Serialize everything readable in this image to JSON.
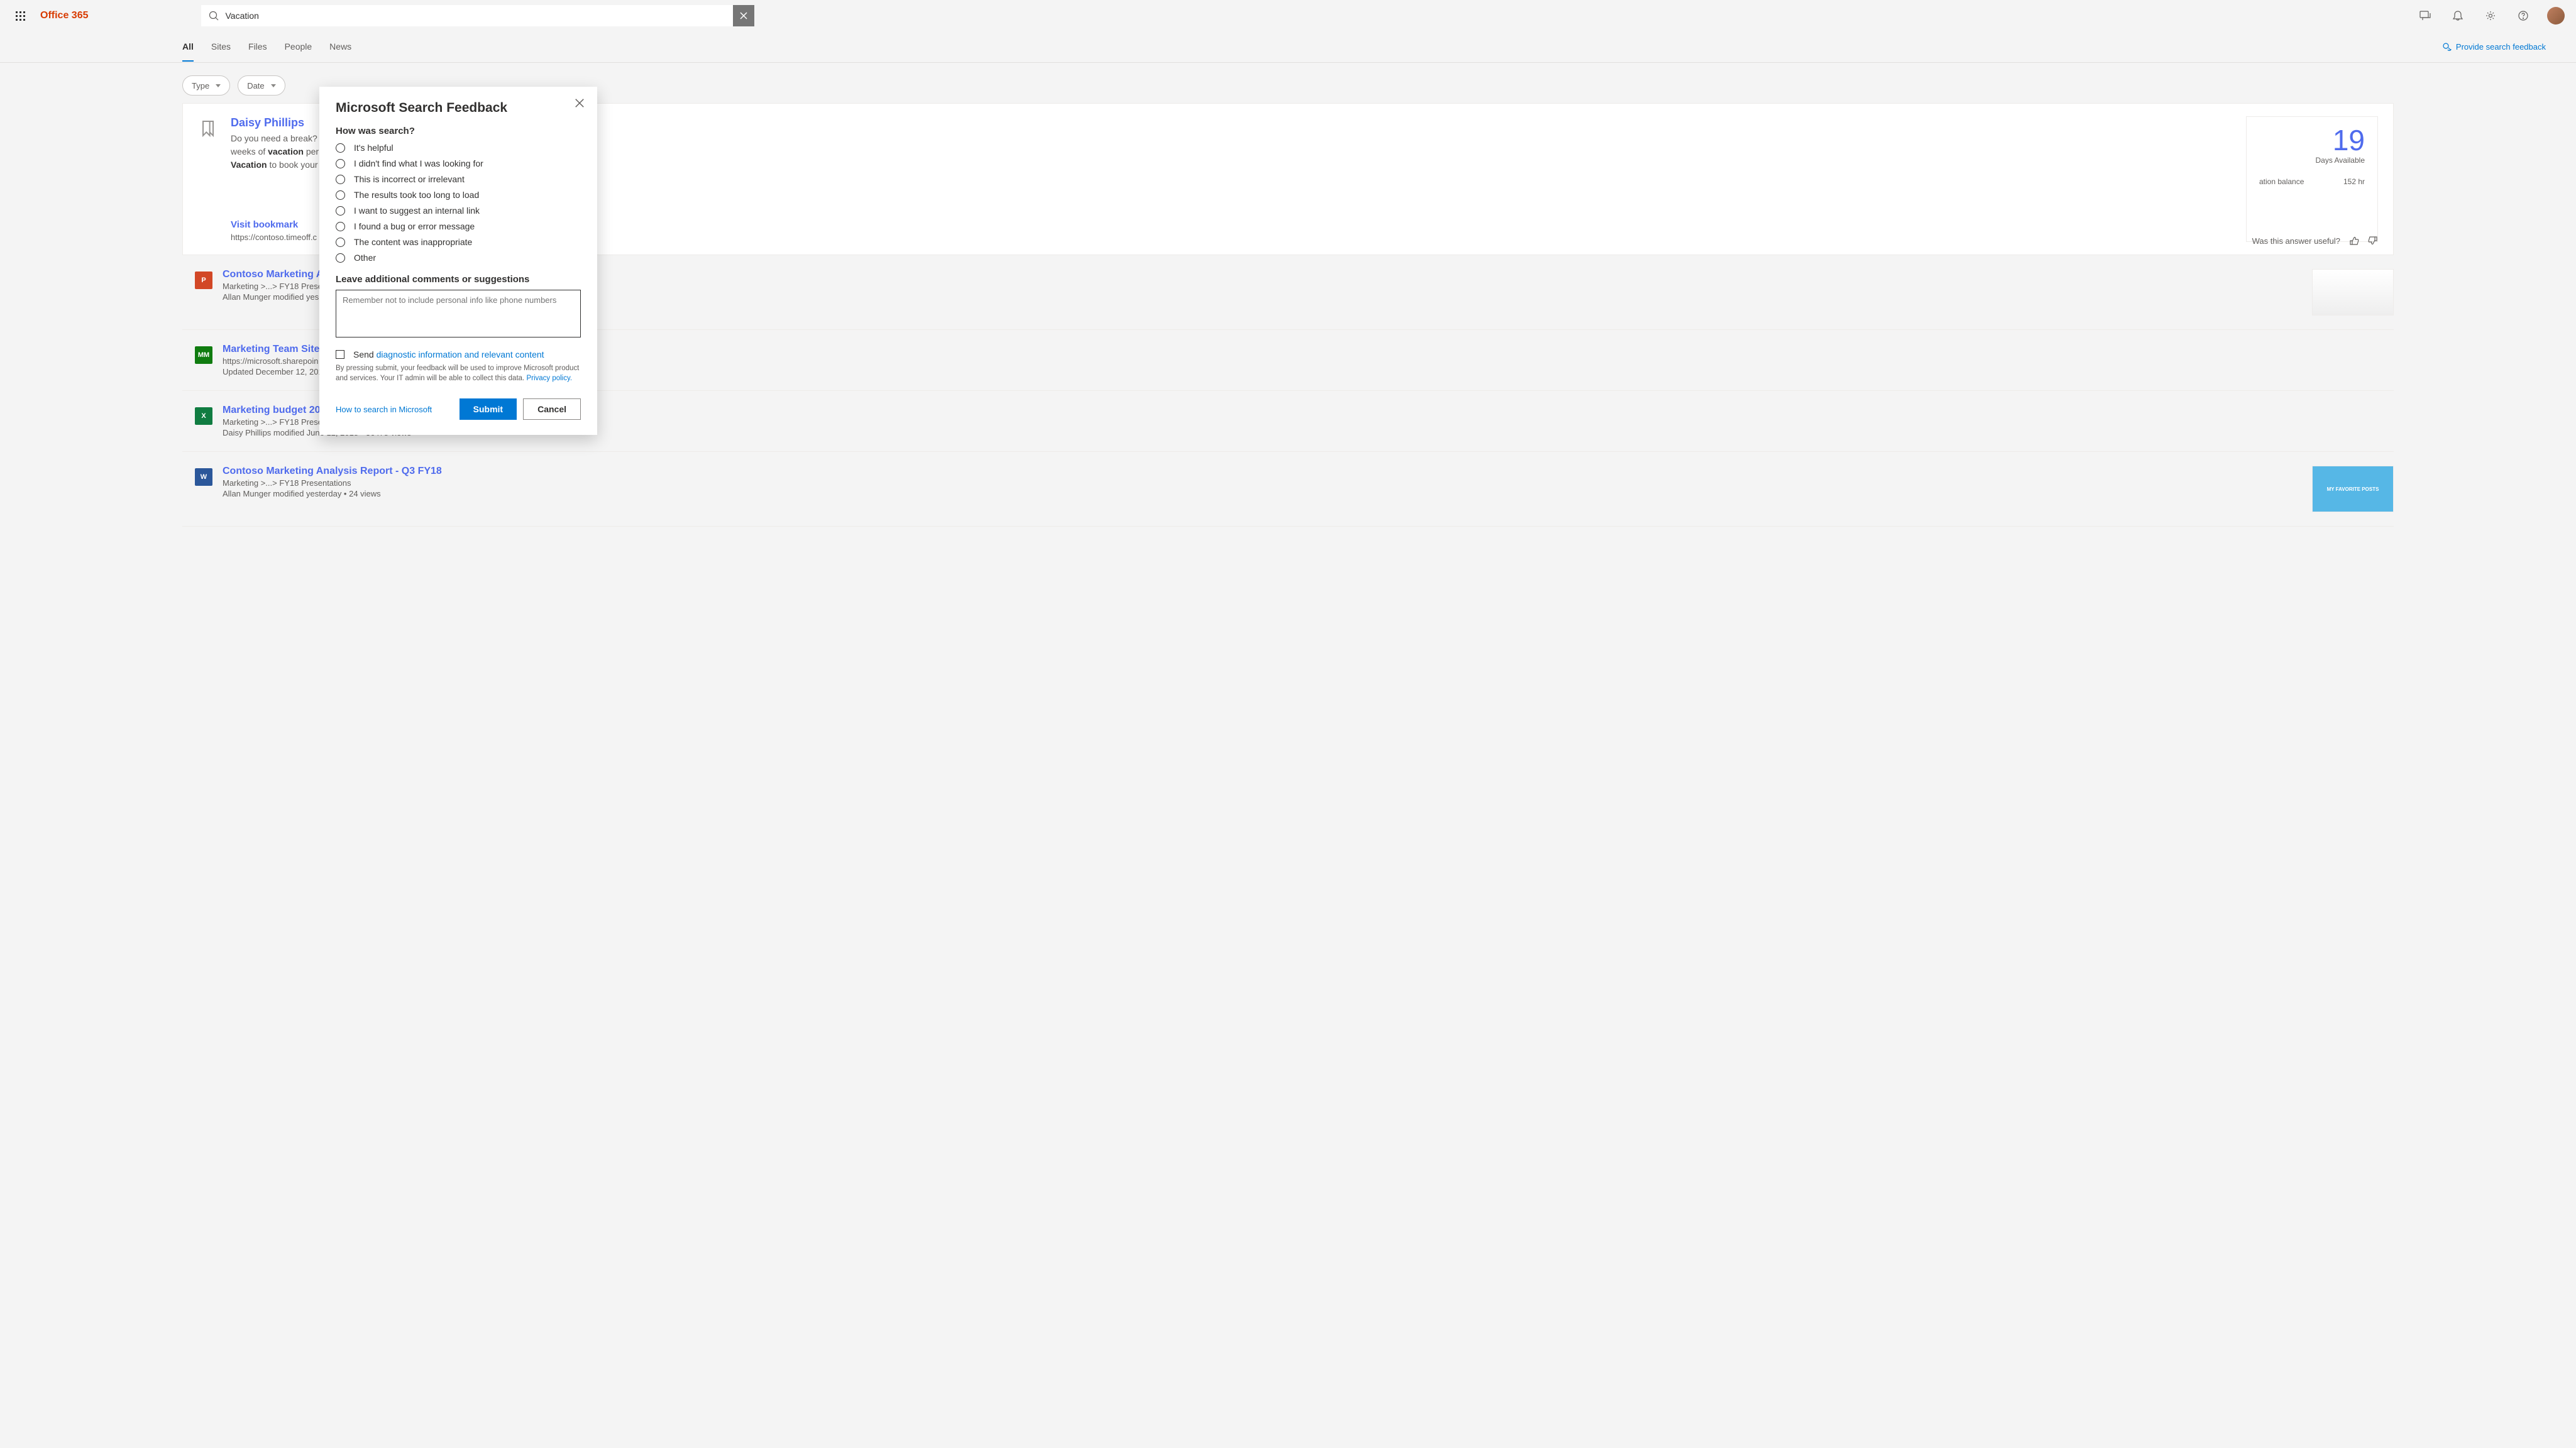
{
  "brand": "Office 365",
  "search": {
    "value": "Vacation"
  },
  "tabs": [
    "All",
    "Sites",
    "Files",
    "People",
    "News"
  ],
  "activeTab": "All",
  "feedbackLink": "Provide search feedback",
  "filters": [
    "Type",
    "Date"
  ],
  "answer": {
    "title": "Daisy Phillips",
    "desc_pre": "Do you need a break? ",
    "desc_mid1": "weeks of ",
    "desc_bold1": "vacation",
    "desc_mid2": " per ",
    "desc_bold2": "Vacation",
    "desc_end": " to book your ",
    "visit": "Visit bookmark",
    "url": "https://contoso.timeoff.c",
    "statBig": "19",
    "statLabel": "Days Available",
    "statRow1a": "ation balance",
    "statRow1b": "152  hr",
    "useful": "Was this answer useful?"
  },
  "results": [
    {
      "icon": "P",
      "iconClass": "pp",
      "title": "Contoso Marketing An",
      "path": "Marketing >...> FY18 Prese",
      "meta": "Allan Munger modified yes",
      "thumb": "cal"
    },
    {
      "icon": "MM",
      "iconClass": "site",
      "title": "Marketing Team Site",
      "path": "https://microsoft.sharepoin",
      "meta": "Updated December 12, 201",
      "thumb": ""
    },
    {
      "icon": "X",
      "iconClass": "xl",
      "title": "Marketing budget 2018",
      "path": "Marketing >...> FY18 Presentations",
      "meta": "Daisy Phillips modified June 12, 2018  •  36478 views",
      "thumb": ""
    },
    {
      "icon": "W",
      "iconClass": "wd",
      "title": "Contoso Marketing Analysis Report - Q3 FY18",
      "path": "Marketing >...> FY18 Presentations",
      "meta": "Allan Munger modified yesterday  •  24 views",
      "thumb": "fav"
    }
  ],
  "modal": {
    "title": "Microsoft Search Feedback",
    "q1": "How was search?",
    "options": [
      "It's helpful",
      "I didn't find what I was looking for",
      "This is incorrect or irrelevant",
      "The results took too long to load",
      "I want to suggest an internal link",
      "I found a bug or error message",
      "The content was inappropriate",
      "Other"
    ],
    "q2": "Leave additional comments or suggestions",
    "placeholder": "Remember not to include personal info like phone numbers",
    "sendPre": "Send ",
    "diagLink": "diagnostic information and relevant content",
    "disclaimer": "By pressing submit, your feedback will be used to improve Microsoft product and services. Your IT admin will be able to collect this data. ",
    "privacy": "Privacy policy.",
    "help": "How to search in Microsoft",
    "submit": "Submit",
    "cancel": "Cancel"
  },
  "favPosts": "MY FAVORITE POSTS"
}
